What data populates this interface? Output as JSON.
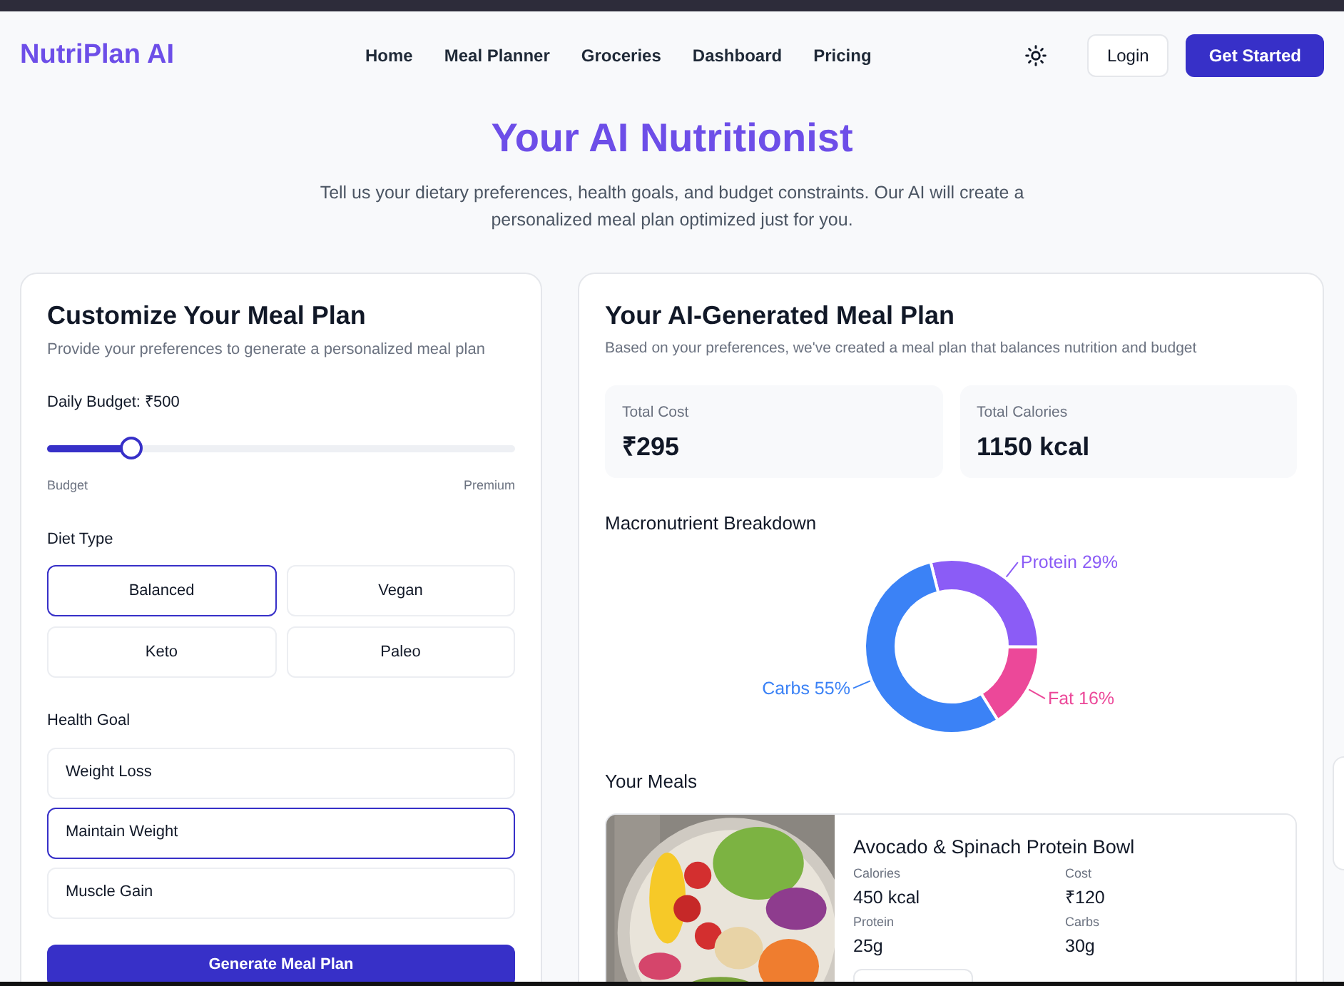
{
  "brand": "NutriPlan AI",
  "nav": [
    {
      "label": "Home"
    },
    {
      "label": "Meal Planner"
    },
    {
      "label": "Groceries"
    },
    {
      "label": "Dashboard"
    },
    {
      "label": "Pricing"
    }
  ],
  "actions": {
    "login": "Login",
    "get_started": "Get Started"
  },
  "hero": {
    "title": "Your AI Nutritionist",
    "subtitle": "Tell us your dietary preferences, health goals, and budget constraints. Our AI will create a personalized meal plan optimized just for you."
  },
  "customize": {
    "title": "Customize Your Meal Plan",
    "subtitle": "Provide your preferences to generate a personalized meal plan",
    "budget": {
      "label": "Daily Budget: ₹500",
      "level": 0.18,
      "min_label": "Budget",
      "max_label": "Premium"
    },
    "diet_type": {
      "label": "Diet Type",
      "options": [
        {
          "label": "Balanced",
          "selected": true
        },
        {
          "label": "Vegan",
          "selected": false
        },
        {
          "label": "Keto",
          "selected": false
        },
        {
          "label": "Paleo",
          "selected": false
        }
      ]
    },
    "health_goal": {
      "label": "Health Goal",
      "options": [
        {
          "label": "Weight Loss",
          "selected": false
        },
        {
          "label": "Maintain Weight",
          "selected": true
        },
        {
          "label": "Muscle Gain",
          "selected": false
        }
      ]
    },
    "generate": "Generate Meal Plan"
  },
  "plan": {
    "title": "Your AI-Generated Meal Plan",
    "subtitle": "Based on your preferences, we've created a meal plan that balances nutrition and budget",
    "stats": [
      {
        "label": "Total Cost",
        "value": "₹295"
      },
      {
        "label": "Total Calories",
        "value": "1150 kcal"
      }
    ],
    "macro_title": "Macronutrient Breakdown",
    "chart_data": {
      "type": "donut",
      "categories": [
        "Protein",
        "Fat",
        "Carbs"
      ],
      "values": [
        29,
        16,
        55
      ],
      "colors": [
        "#8b5cf6",
        "#ec4899",
        "#3b82f6"
      ],
      "value_labels": [
        "29%",
        "16%",
        "55%"
      ]
    },
    "meals_title": "Your Meals",
    "meals": [
      {
        "kind": "picture",
        "name": "Avocado & Spinach Protein Bowl",
        "facts": [
          {
            "label": "Calories",
            "value": "450 kcal"
          },
          {
            "label": "Cost",
            "value": "₹120"
          },
          {
            "label": "Protein",
            "value": "25g"
          },
          {
            "label": "Carbs",
            "value": "30g"
          }
        ]
      }
    ]
  }
}
